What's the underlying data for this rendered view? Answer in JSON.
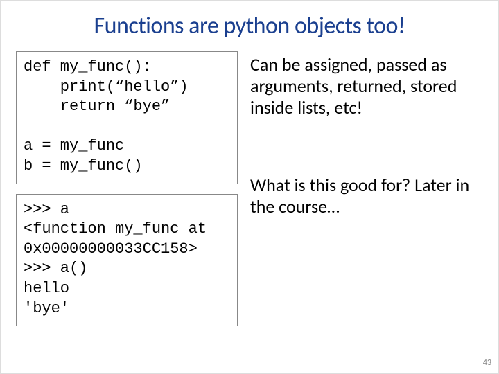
{
  "title": "Functions are python objects too!",
  "code1": "def my_func():\n    print(“hello”)\n    return “bye”\n\na = my_func\nb = my_func()",
  "code2": ">>> a\n<function my_func at\n0x00000000033CC158>\n>>> a()\nhello\n'bye'",
  "para1": "Can be assigned, passed as arguments, returned, stored inside lists, etc!",
  "para2": "What is this good for? Later in the course…",
  "page_number": "43"
}
